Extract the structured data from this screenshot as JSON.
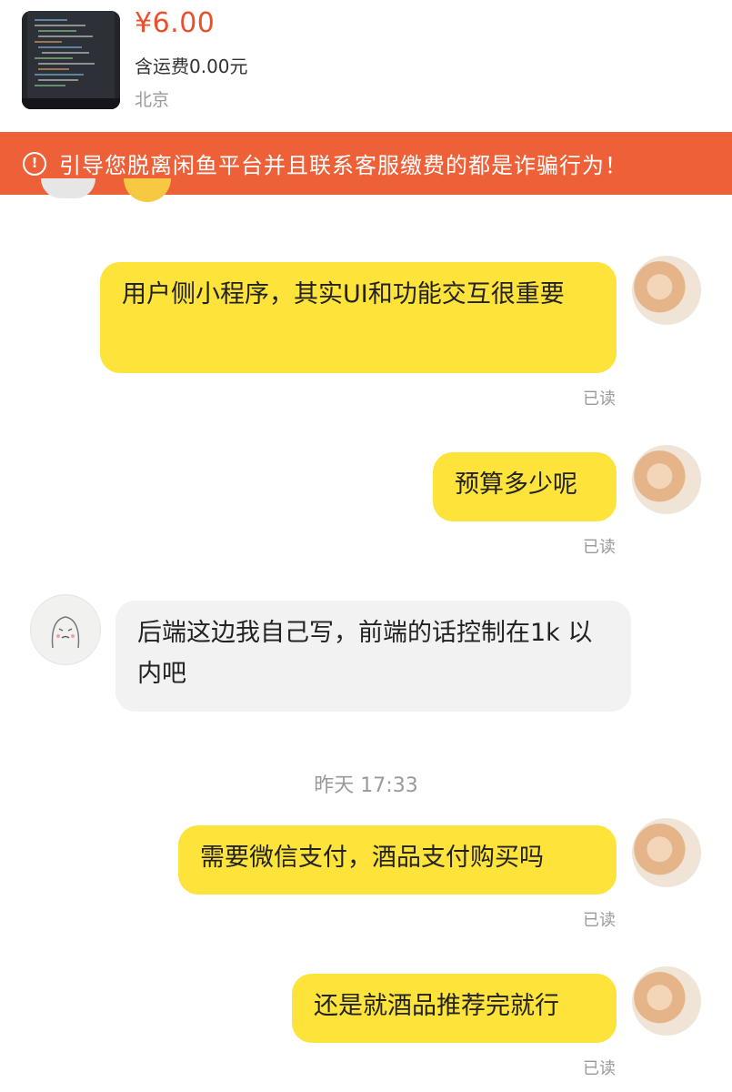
{
  "product": {
    "price": "¥6.00",
    "shipping": "含运费0.00元",
    "location": "北京"
  },
  "warning": {
    "icon": "exclamation-circle-icon",
    "text": "引导您脱离闲鱼平台并且联系客服缴费的都是诈骗行为！",
    "color": "#ed6038"
  },
  "colors": {
    "my_bubble": "#fde33a",
    "their_bubble": "#f2f2f2",
    "price": "#e8502f"
  },
  "messages": [
    {
      "from": "me",
      "text": "用户侧小程序，其实UI和功能交互很重要",
      "status": "已读"
    },
    {
      "from": "me",
      "text": "预算多少呢",
      "status": "已读"
    },
    {
      "from": "them",
      "text": "后端这边我自己写，前端的话控制在1k 以内吧"
    },
    {
      "from": "me",
      "text": "需要微信支付，酒品支付购买吗",
      "status": "已读"
    },
    {
      "from": "me",
      "text": "还是就酒品推荐完就行",
      "status": "已读"
    }
  ],
  "timestamp": "昨天 17:33"
}
